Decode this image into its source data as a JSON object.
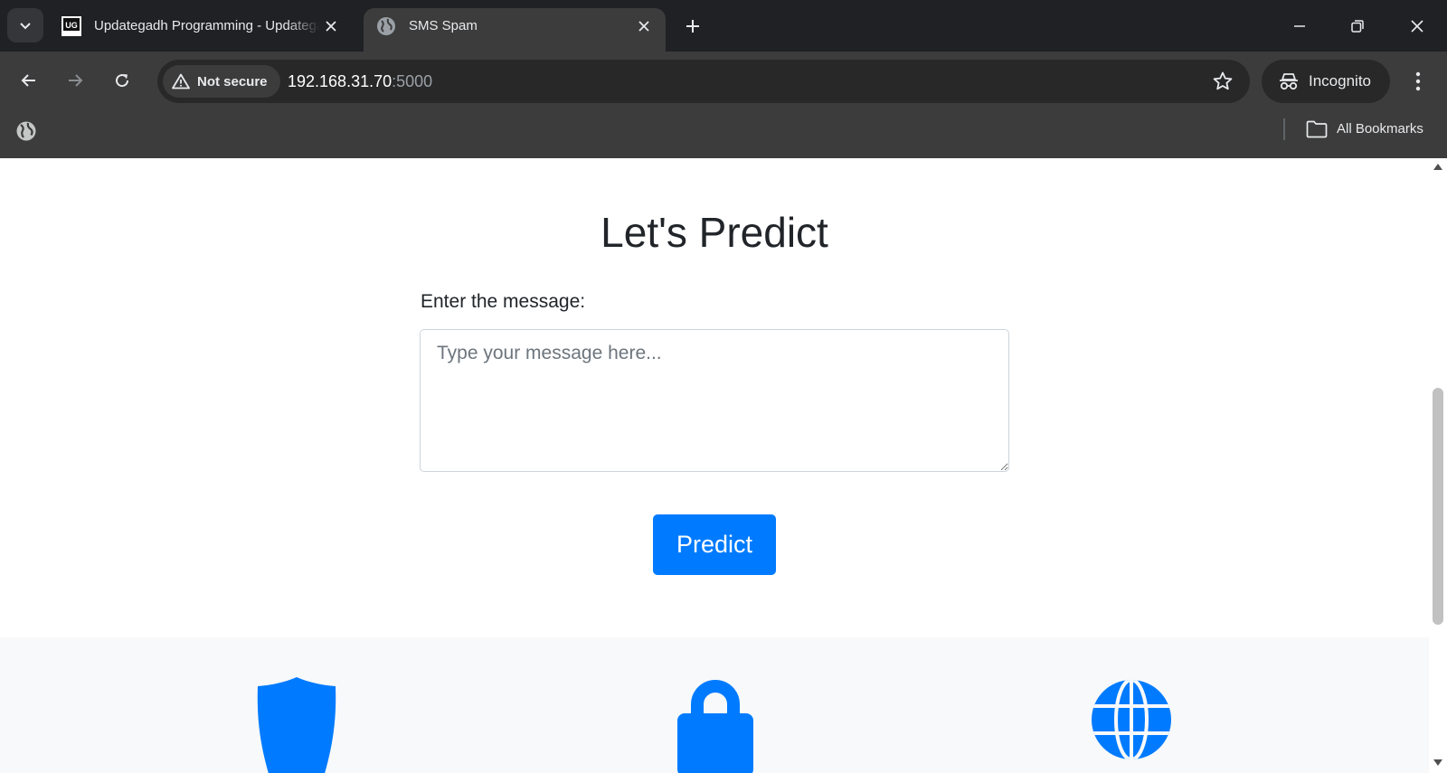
{
  "browser": {
    "tabs": [
      {
        "title": "Updategadh Programming - Updategadh",
        "active": false,
        "favicon": "ug-logo-icon"
      },
      {
        "title": "SMS Spam",
        "active": true,
        "favicon": "globe-icon"
      }
    ],
    "address": {
      "security_label": "Not secure",
      "host": "192.168.31.70",
      "port": ":5000"
    },
    "profile_label": "Incognito",
    "bookmarks": {
      "all_label": "All Bookmarks"
    }
  },
  "page": {
    "title": "Let's Predict",
    "message_label": "Enter the message:",
    "message_placeholder": "Type your message here...",
    "message_value": "",
    "predict_label": "Predict",
    "feature_icons": [
      "shield-icon",
      "lock-icon",
      "globe-icon"
    ]
  },
  "colors": {
    "accent": "#007bff",
    "chrome_dark": "#202124",
    "chrome_toolbar": "#3c3c3c",
    "page_text": "#212529",
    "feature_bg": "#f8f9fa"
  }
}
